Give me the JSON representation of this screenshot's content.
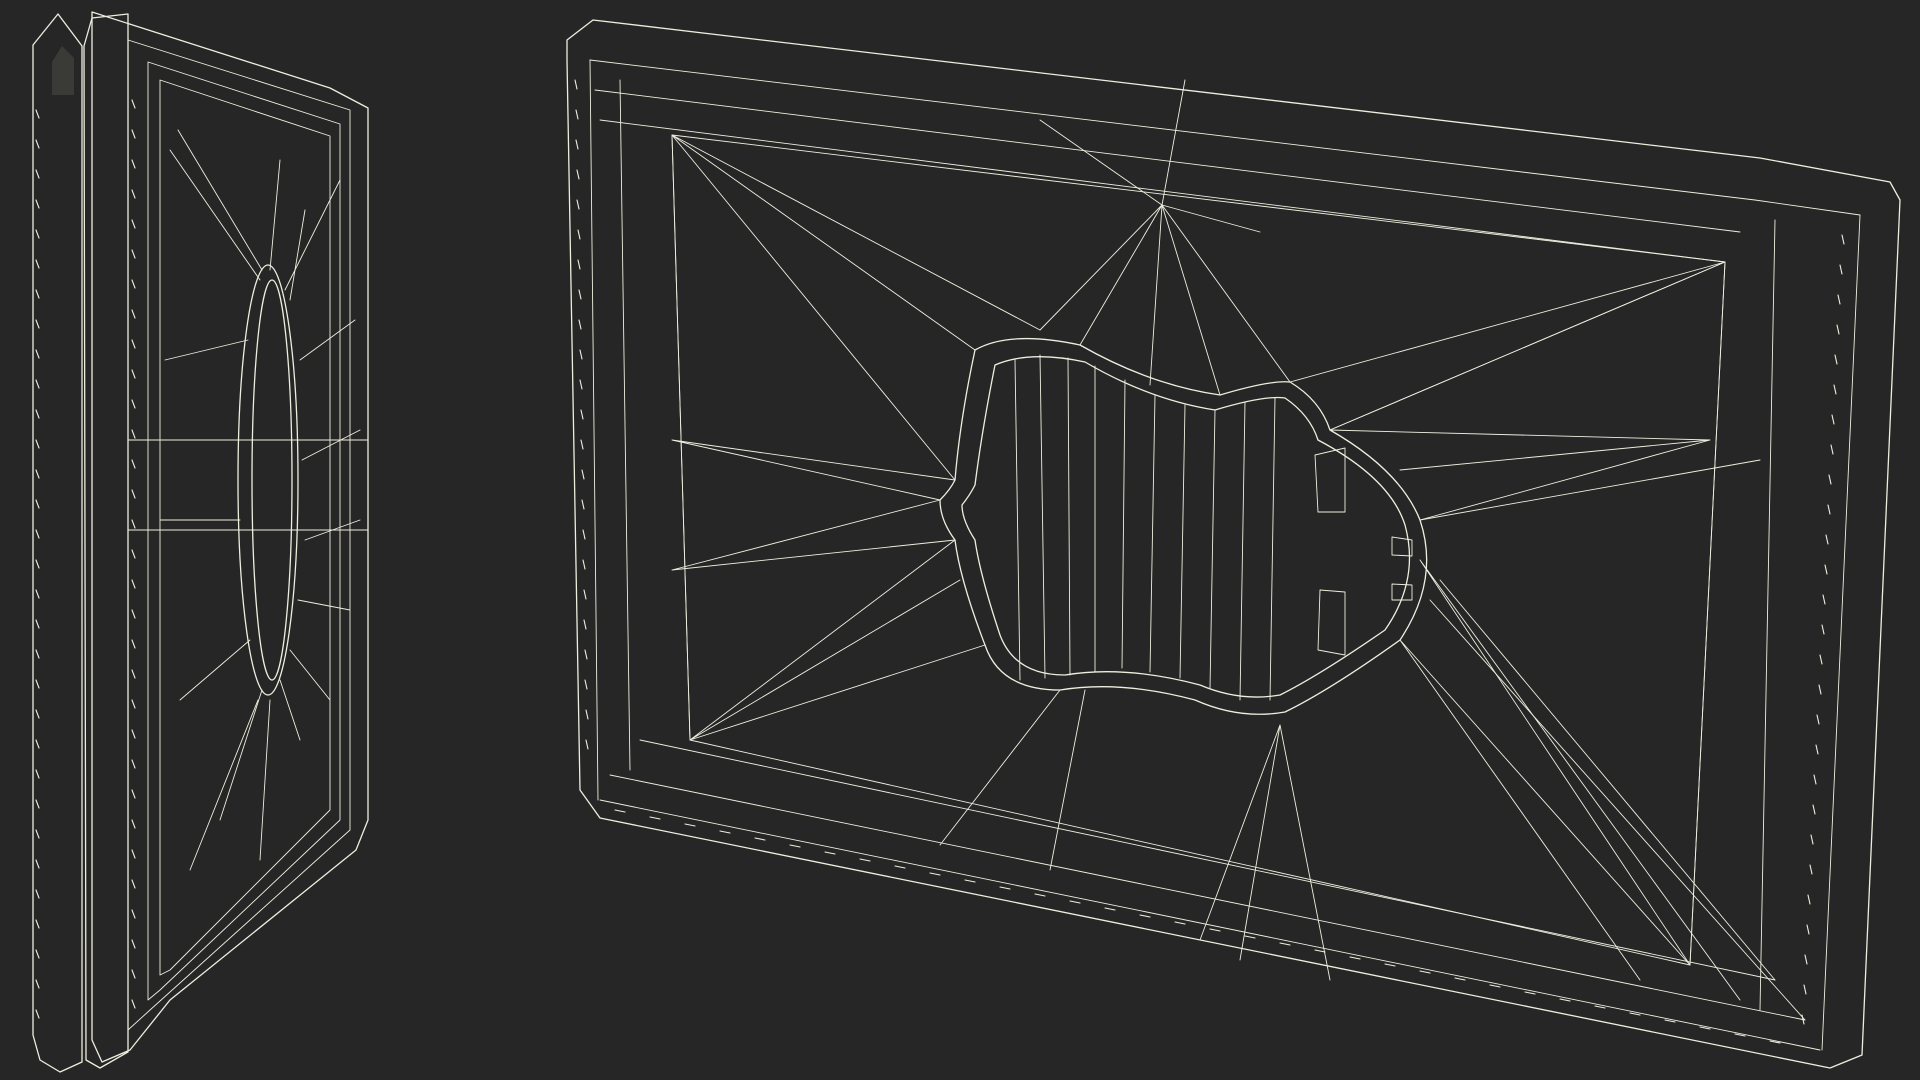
{
  "scene": {
    "subject": "wireframe-3d-model-render",
    "views": [
      "side-view",
      "perspective-view"
    ]
  },
  "colors": {
    "background": "#262626",
    "surface": "#7b7b70",
    "surface_light": "#85857a",
    "surface_dark": "#6b6b62",
    "wire": "#eeeedf",
    "cavity": "#3a3a36",
    "shadow": "#1e1e1c"
  }
}
